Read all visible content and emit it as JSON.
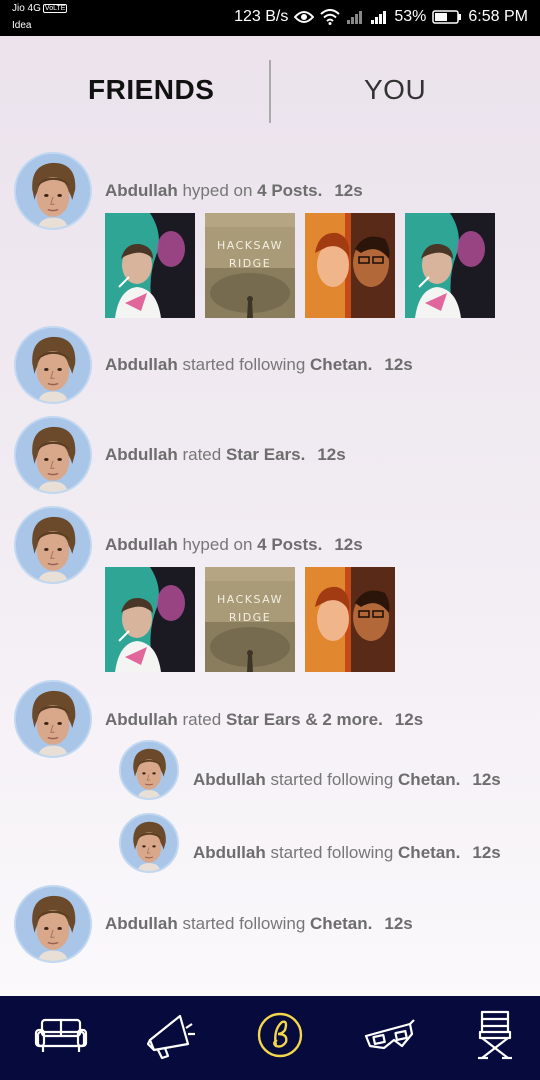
{
  "status_bar": {
    "carrier_top": "Jio 4G",
    "volte": "VoLTE",
    "carrier_bottom": "Idea",
    "net_speed": "123 B/s",
    "battery": "53%",
    "time": "6:58 PM"
  },
  "tabs": {
    "friends": "FRIENDS",
    "you": "YOU"
  },
  "feed": {
    "item1": {
      "user": "Abdullah",
      "verb": "hyped on",
      "object": "4 Posts.",
      "time": "12s",
      "posters": [
        "fight-club",
        "hacksaw-ridge",
        "fire-portrait",
        "fight-club"
      ]
    },
    "item2": {
      "user": "Abdullah",
      "verb": "started following",
      "object": "Chetan.",
      "time": "12s"
    },
    "item3": {
      "user": "Abdullah",
      "verb": "rated",
      "object": "Star Ears.",
      "time": "12s"
    },
    "item4": {
      "user": "Abdullah",
      "verb": "hyped on",
      "object": "4 Posts.",
      "time": "12s",
      "posters": [
        "fight-club",
        "hacksaw-ridge",
        "fire-portrait"
      ]
    },
    "item5": {
      "user": "Abdullah",
      "verb": "rated",
      "object": "Star Ears & 2 more.",
      "time": "12s"
    },
    "item5_sub1": {
      "user": "Abdullah",
      "verb": "started following",
      "object": "Chetan.",
      "time": "12s"
    },
    "item5_sub2": {
      "user": "Abdullah",
      "verb": "started following",
      "object": "Chetan.",
      "time": "12s"
    },
    "item6": {
      "user": "Abdullah",
      "verb": "started following",
      "object": "Chetan.",
      "time": "12s"
    }
  },
  "poster_titles": {
    "hacksaw": "HACKSAW\nRIDGE"
  },
  "bottom_nav": [
    "sofa-icon",
    "megaphone-icon",
    "logo-b-icon",
    "3d-glasses-icon",
    "director-chair-icon"
  ],
  "colors": {
    "nav_bg": "#060a3c",
    "nav_active": "#f2d64b",
    "nav_icon": "#ffffff",
    "avatar_bg": "#a9c6e9"
  }
}
